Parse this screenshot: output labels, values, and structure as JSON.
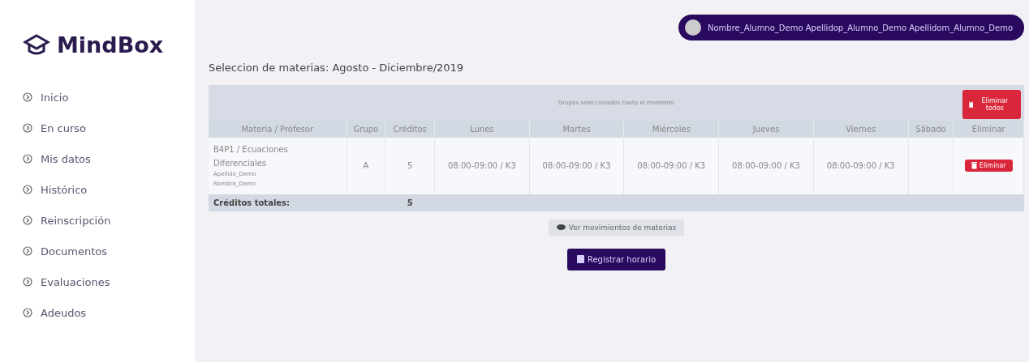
{
  "sidebar": {
    "logo": "MindBox",
    "items": [
      {
        "label": "Inicio"
      },
      {
        "label": "En curso"
      },
      {
        "label": "Mis datos"
      },
      {
        "label": "Histórico"
      },
      {
        "label": "Reinscripción"
      },
      {
        "label": "Documentos"
      },
      {
        "label": "Evaluaciones"
      },
      {
        "label": "Adeudos"
      }
    ]
  },
  "user": {
    "name": "Nombre_Alumno_Demo Apellidop_Alumno_Demo Apellidom_Alumno_Demo"
  },
  "title": "Seleccion de materias: Agosto - Diciembre/2019",
  "table": {
    "caption": "Grupos seleccionados hasta el momento",
    "delete_all": "Eliminar todos",
    "columns": [
      "Materia / Profesor",
      "Grupo",
      "Créditos",
      "Lunes",
      "Martes",
      "Miércoles",
      "Jueves",
      "Viernes",
      "Sábado",
      "Eliminar"
    ],
    "rows": [
      {
        "subject": "B4P1 / Ecuaciones Diferenciales",
        "teacher_last": "Apellido_Demo",
        "teacher_first": "Nombre_Demo",
        "group": "A",
        "credits": "5",
        "days": [
          "08:00-09:00 / K3",
          "08:00-09:00 / K3",
          "08:00-09:00 / K3",
          "08:00-09:00 / K3",
          "08:00-09:00 / K3"
        ],
        "delete": "Eliminar"
      }
    ],
    "total_label": "Créditos totales:",
    "total": "5"
  },
  "movements_button": "Ver movimientos de materias",
  "register_button": "Registrar horario"
}
